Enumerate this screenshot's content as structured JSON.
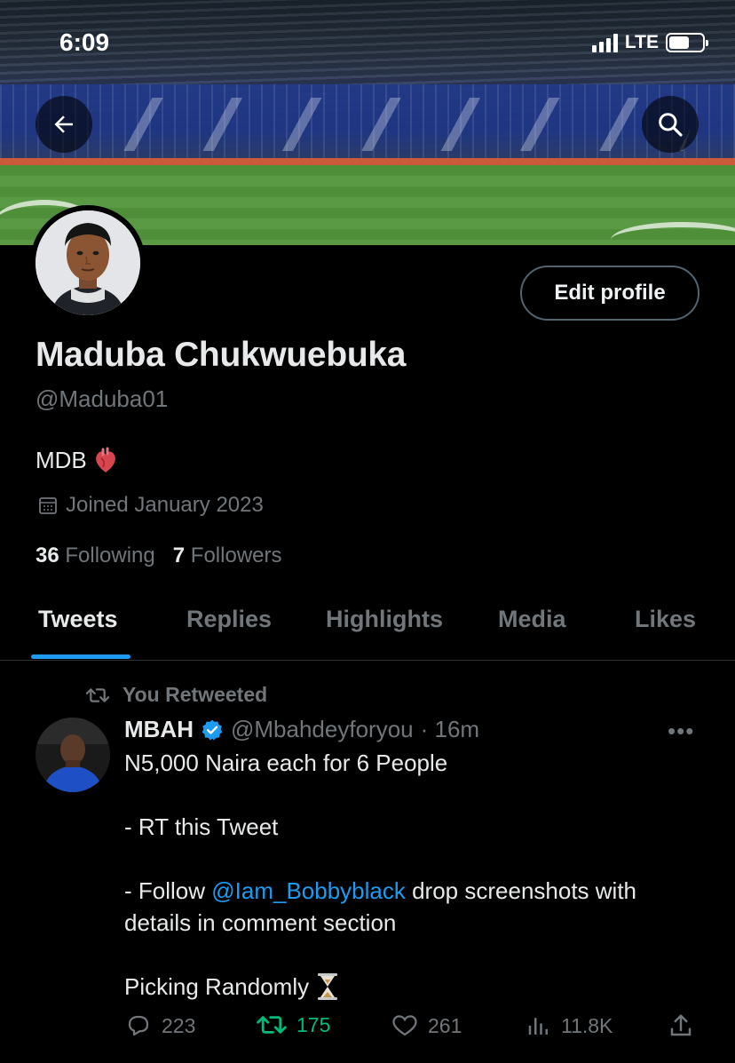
{
  "status_bar": {
    "time": "6:09",
    "network": "LTE"
  },
  "profile": {
    "name": "Maduba Chukwuebuka",
    "handle": "@Maduba01",
    "bio": "MDB",
    "joined": "Joined January 2023",
    "following_count": "36",
    "following_label": "Following",
    "followers_count": "7",
    "followers_label": "Followers",
    "edit_label": "Edit profile"
  },
  "tabs": [
    {
      "label": "Tweets",
      "active": true
    },
    {
      "label": "Replies",
      "active": false
    },
    {
      "label": "Highlights",
      "active": false
    },
    {
      "label": "Media",
      "active": false
    },
    {
      "label": "Likes",
      "active": false
    }
  ],
  "tweet": {
    "retweet_label": "You Retweeted",
    "author_name": "MBAH",
    "author_handle": "@Mbahdeyforyou",
    "time": "· 16m",
    "line1": "N5,000 Naira each for 6 People",
    "line2": "- RT this Tweet",
    "line3_prefix": "- Follow ",
    "line3_mention": "@Iam_Bobbyblack",
    "line3_suffix": " drop screenshots with",
    "line4": "details in comment section",
    "line5": "Picking Randomly",
    "replies": "223",
    "retweets": "175",
    "likes": "261",
    "views": "11.8K"
  },
  "colors": {
    "accent": "#1d9bf0",
    "retweet": "#00ba7c",
    "muted": "#71767b"
  },
  "icons": [
    "back-arrow-icon",
    "search-icon",
    "calendar-icon",
    "heart-organ-emoji",
    "retweet-icon",
    "verified-badge-icon",
    "more-icon",
    "reply-icon",
    "like-icon",
    "views-icon",
    "share-icon",
    "hourglass-emoji"
  ]
}
